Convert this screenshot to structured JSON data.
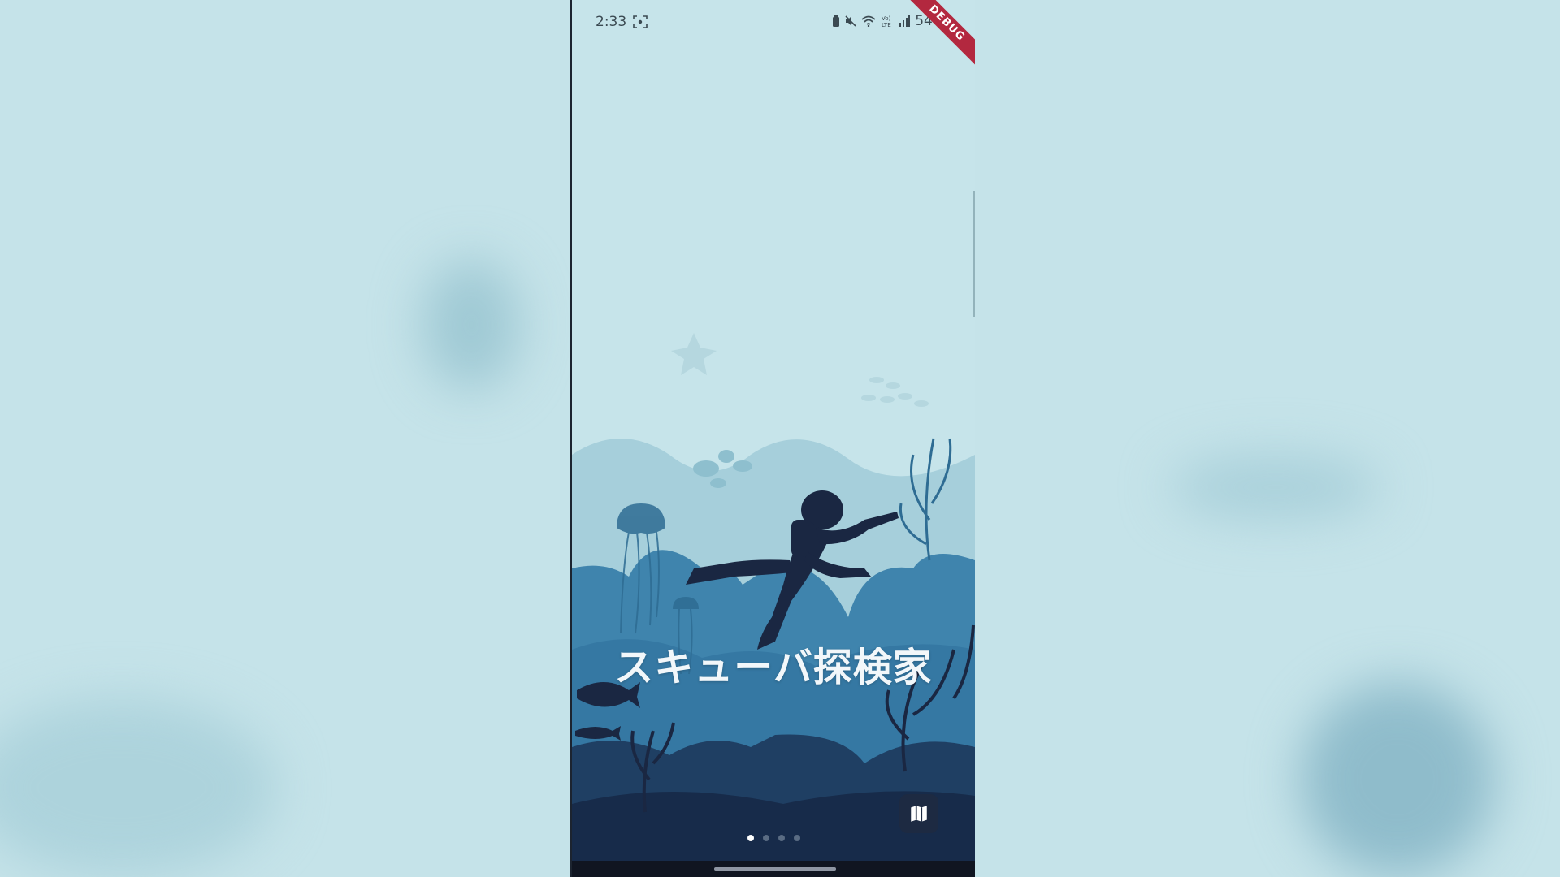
{
  "status_bar": {
    "time": "2:33",
    "battery": "54%",
    "icons": [
      "screenshot-icon",
      "battery-saver-icon",
      "mute-icon",
      "wifi-icon",
      "volte-icon",
      "signal-icon"
    ],
    "lte_label": "Vo)) LTE"
  },
  "debug_banner": "DEBUG",
  "title": "スキューバ探検家",
  "map_button": {
    "icon": "map-icon"
  },
  "pager": {
    "count": 4,
    "active_index": 0
  },
  "colors": {
    "water_light": "#c6e4ea",
    "reef_mid": "#3d7fa6",
    "reef_dark": "#1d3a5c",
    "silhouette": "#1a2742",
    "debug_ribbon": "#b3283f"
  }
}
